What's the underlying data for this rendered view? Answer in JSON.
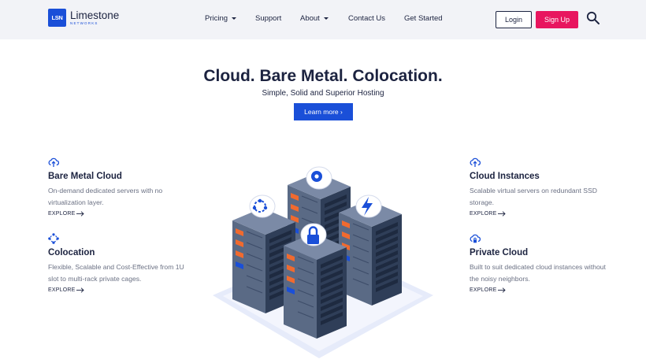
{
  "header": {
    "logo": {
      "mark": "LSN",
      "name": "Limestone",
      "sub": "NETWORKS"
    },
    "nav": [
      {
        "label": "Pricing",
        "has_dropdown": true
      },
      {
        "label": "Support",
        "has_dropdown": false
      },
      {
        "label": "About",
        "has_dropdown": true
      },
      {
        "label": "Contact Us",
        "has_dropdown": false
      },
      {
        "label": "Get Started",
        "has_dropdown": false
      }
    ],
    "login_label": "Login",
    "signup_label": "Sign Up",
    "search_icon": "search-icon"
  },
  "hero": {
    "title": "Cloud. Bare Metal. Colocation.",
    "subtitle": "Simple, Solid and Superior Hosting",
    "cta_label": "Learn more ›"
  },
  "features": [
    {
      "icon": "cloud-upload-icon",
      "title": "Bare Metal Cloud",
      "description": "On-demand dedicated servers with no virtualization layer.",
      "link": "EXPLORE"
    },
    {
      "icon": "network-nodes-icon",
      "title": "Colocation",
      "description": "Flexible, Scalable and Cost-Effective from 1U slot to multi-rack private cages.",
      "link": "EXPLORE"
    },
    {
      "icon": "cloud-upload-icon",
      "title": "Cloud Instances",
      "description": "Scalable virtual servers on redundant SSD storage.",
      "link": "EXPLORE"
    },
    {
      "icon": "cloud-lock-icon",
      "title": "Private Cloud",
      "description": "Built to suit dedicated cloud instances without the noisy neighbors.",
      "link": "EXPLORE"
    }
  ],
  "colors": {
    "brand_blue": "#1a4fd8",
    "signup_pink": "#e8165f",
    "text_dark": "#1c2340",
    "text_muted": "#6b7184",
    "header_bg": "#f2f3f7"
  }
}
